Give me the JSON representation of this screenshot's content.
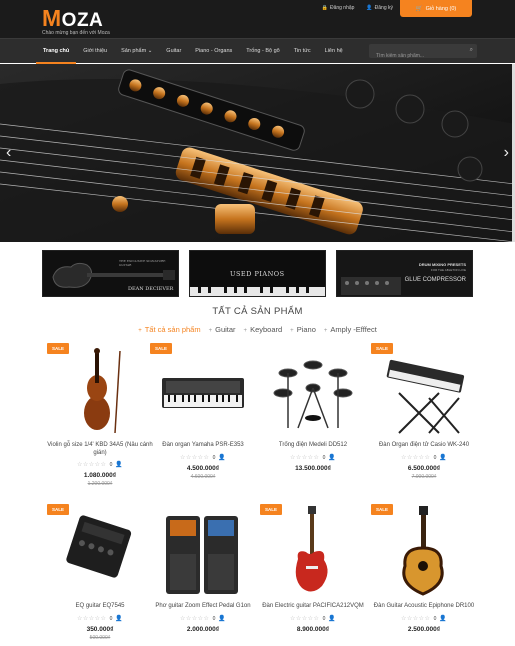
{
  "header": {
    "logo_first": "M",
    "logo_rest": "OZA",
    "tagline": "Chào mừng bạn đến với Moza",
    "login_label": "Đăng nhập",
    "register_label": "Đăng ký",
    "cart_label": "Giỏ hàng (0)"
  },
  "nav": {
    "items": [
      "Trang chủ",
      "Giới thiệu",
      "Sản phẩm",
      "Guitar",
      "Piano - Organs",
      "Trống - Bộ gõ",
      "Tin tức",
      "Liên hệ"
    ],
    "search_placeholder": "Tìm kiếm sản phẩm..."
  },
  "banners": {
    "b1_main": "DEAN DECIEVER",
    "b1_sub": "THE EXCLUSIVE SIGNATURE GUITAR",
    "b2": "USED PIANOS",
    "b3_line1": "DRUM MIXING PRESETS",
    "b3_line2": "FOR THE ABLETON LIVE",
    "b3_line3": "GLUE COMPRESSOR"
  },
  "section": {
    "title": "TẤT CẢ SẢN PHẨM",
    "categories": [
      "Tất cả sản phẩm",
      "Guitar",
      "Keyboard",
      "Piano",
      "Amply -Efffect"
    ]
  },
  "sale_label": "SALE",
  "products": [
    {
      "name": "Violin gỗ size 1/4' KBD 34A5 (Nâu cánh gián)",
      "price": "1.080.000₫",
      "old": "1.200.000₫",
      "rating_count": "0"
    },
    {
      "name": "Đàn organ Yamaha PSR-E353",
      "price": "4.500.000₫",
      "old": "4.600.000₫",
      "rating_count": "0"
    },
    {
      "name": "Trống điện Medeli DD512",
      "price": "13.500.000₫",
      "old": "",
      "rating_count": "0"
    },
    {
      "name": "Đàn Organ điện tử Casio WK-240",
      "price": "6.500.000₫",
      "old": "7.000.000₫",
      "rating_count": "0"
    },
    {
      "name": "EQ guitar EQ7545",
      "price": "350.000₫",
      "old": "500.000₫",
      "rating_count": "0"
    },
    {
      "name": "Phơ guitar Zoom Effect Pedal G1on",
      "price": "2.000.000₫",
      "old": "",
      "rating_count": "0"
    },
    {
      "name": "Đàn Electric guitar PACIFICA212VQM",
      "price": "8.900.000₫",
      "old": "",
      "rating_count": "0"
    },
    {
      "name": "Đàn Guitar Acoustic Epiphone DR100",
      "price": "2.500.000₫",
      "old": "",
      "rating_count": "0"
    }
  ],
  "colors": {
    "accent": "#f5831f",
    "header_bg": "#1b1b1b",
    "nav_bg": "#2d2d2d"
  }
}
